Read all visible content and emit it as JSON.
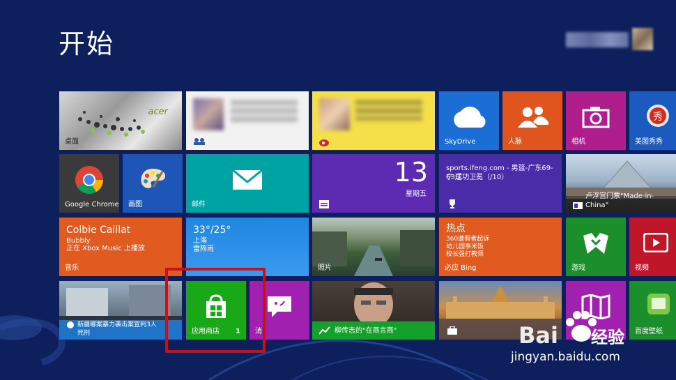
{
  "screen": {
    "title": "开始",
    "colors": {
      "background": "#0d1f5c",
      "highlight": "#c4111a"
    }
  },
  "tiles": {
    "desktop": {
      "label": "桌面",
      "brand": "acer"
    },
    "people_fb": {
      "label": "",
      "icon": "people-icon"
    },
    "weibo": {
      "label": "",
      "icon": "weibo-icon"
    },
    "skydrive": {
      "label": "SkyDrive"
    },
    "people": {
      "label": "人脉"
    },
    "camera": {
      "label": "相机"
    },
    "meitu": {
      "label": "美图秀秀"
    },
    "chrome": {
      "label": "Google Chrome"
    },
    "paint": {
      "label": "画图"
    },
    "mail": {
      "label": "邮件"
    },
    "calendar": {
      "day": "13",
      "weekday": "星期五"
    },
    "sports": {
      "line1": "sports.ifeng.com - 男篮-广东69-63辽",
      "line2": "宁 成功卫冕（/10）"
    },
    "paris": {
      "caption": "卢浮宫门票\"Made-in-China\""
    },
    "music": {
      "title": "Colbie Caillat",
      "song": "Bubbly",
      "status": "正在 Xbox Music 上播放",
      "label": "音乐"
    },
    "weather": {
      "temp": "33°/25°",
      "city": "上海",
      "cond": "雷阵雨"
    },
    "photos": {
      "label": "照片"
    },
    "bing": {
      "title": "热点",
      "l1": "360遭假者起诉",
      "l2": "幼儿园事米饭",
      "l3": "校长强打教师",
      "label": "必应 Bing"
    },
    "games": {
      "label": "游戏"
    },
    "video": {
      "label": "视频"
    },
    "news": {
      "l1": "新疆哪案暴力袭击案宣判3人",
      "l2": "死刑"
    },
    "store": {
      "label": "应用商店",
      "badge": "1"
    },
    "messaging": {
      "label": "消"
    },
    "finance": {
      "caption": "柳传志的\"在商言商\""
    },
    "travel": {
      "label": ""
    },
    "maps": {
      "label": ""
    },
    "baidu_wallpaper": {
      "label": "百度壁纸"
    }
  },
  "watermark": {
    "brand": "Bai",
    "brand_cn": "经验",
    "url": "jingyan.baidu.com"
  }
}
